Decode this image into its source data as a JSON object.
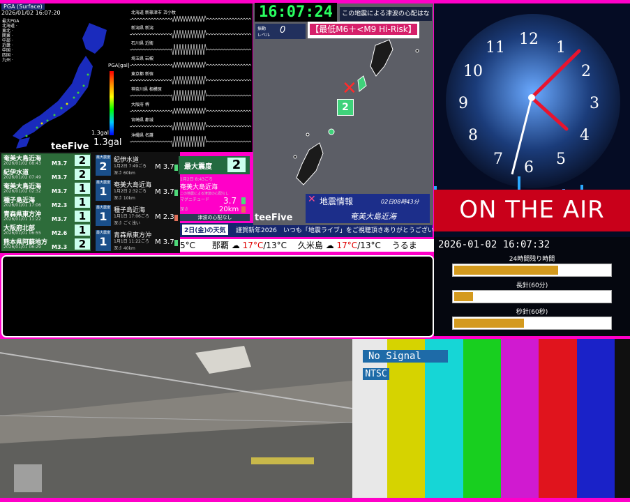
{
  "map": {
    "header": "PGA (Surface)",
    "timestamp": "2026/01/02 16:07:20",
    "pga_label": "PGA[gal]",
    "gal_small": "1.3gal",
    "gal_value": "1.3gal",
    "logo": "teeFive",
    "seismo_labels": [
      "北海道 新篠津市 苫小牧",
      "新潟県 新潟",
      "石川県 近衛",
      "埼玉県 岩槻",
      "東京都 新宿",
      "神奈川県 相模原",
      "大阪府 堺",
      "宮崎県 都城",
      "沖縄県 名護"
    ]
  },
  "eew": {
    "header": "最大震度",
    "rows": [
      {
        "region": "奄美大島近海",
        "time": "2026/01/02 08:43",
        "mag": "M3.7",
        "scale": "2"
      },
      {
        "region": "紀伊水道",
        "time": "2026/01/02 07:49",
        "mag": "M3.7",
        "scale": "2"
      },
      {
        "region": "奄美大島近海",
        "time": "2026/01/02 02:32",
        "mag": "M3.7",
        "scale": "1"
      },
      {
        "region": "種子島近海",
        "time": "2026/01/01 17:06",
        "mag": "M2.3",
        "scale": "1"
      },
      {
        "region": "青森県東方沖",
        "time": "2026/01/01 11:22",
        "mag": "M3.7",
        "scale": "1"
      },
      {
        "region": "大阪府北部",
        "time": "2026/01/01 06:55",
        "mag": "M2.6",
        "scale": "1"
      },
      {
        "region": "熊本県阿蘇地方",
        "time": "2026/01/01 06:29",
        "mag": "M3.3",
        "scale": "2"
      }
    ],
    "details": [
      {
        "scale": "2",
        "region": "紀伊水道",
        "time": "1月2日 7:49ごろ",
        "depth": "深さ 60km",
        "mag": "M 3.7"
      },
      {
        "scale": "1",
        "region": "奄美大島近海",
        "time": "1月2日 2:32ごろ",
        "depth": "深さ 10km",
        "mag": "M 3.7"
      },
      {
        "scale": "1",
        "region": "種子島近海",
        "time": "1月1日 17:06ごろ",
        "depth": "深さ ごく浅い",
        "mag": "M 2.3"
      },
      {
        "scale": "1",
        "region": "青森県東方沖",
        "time": "1月1日 11:22ごろ",
        "depth": "深さ 40km",
        "mag": "M 3.7"
      }
    ],
    "max_label": "最大震度",
    "max_value": "2",
    "max_time": "1月2日 8:43ごろ",
    "max_region": "奄美大島近海",
    "max_note": "この地震による津波の心配なし",
    "mag_label": "マグニチュード",
    "mag_value": "3.7",
    "depth_label": "深さ",
    "depth_value": "20km",
    "tsunami": "津波の心配なし"
  },
  "weather": {
    "date": "2日(金)の天気",
    "message": "謹賀新年2026　いつも「地震ライブ」をご視聴頂きありがとうございます!",
    "ticker_a": "5°C　　那覇",
    "temp_a_hi": "17°C",
    "temp_a_lo": "/13°C",
    "ticker_b": "　久米島",
    "temp_b_hi": "17°C",
    "temp_b_lo": "/13°C",
    "ticker_c": "　うるま"
  },
  "region_map": {
    "clock": "16:07:24",
    "note": "この地震による津波の心配はなし",
    "shindo_label": "振動\nレベル",
    "shindo_value": "0",
    "risk": "【最低M6＋<M9 Hi-Risk】",
    "pin": "2",
    "quake_title": "地震情報",
    "quake_date": "02日08時43分",
    "quake_region": "奄美大島近海",
    "logo": "teeFive"
  },
  "clock": {
    "on_air": "ON THE AIR",
    "datetime": "2026-01-02 16:07:32",
    "label_24h": "24時間残り時間",
    "label_minute": "長針(60分)",
    "label_second": "秒針(60秒)",
    "progress_24h": 0.67,
    "progress_minute": 0.12,
    "progress_second": 0.45
  },
  "test_card": {
    "no_signal": "No Signal",
    "ntsc": "NTSC",
    "bar_colors": [
      "#e8e8e8",
      "#d6d300",
      "#16d6d6",
      "#18cf1f",
      "#d01ad0",
      "#e0141d",
      "#1a22c8",
      "#101010"
    ]
  }
}
